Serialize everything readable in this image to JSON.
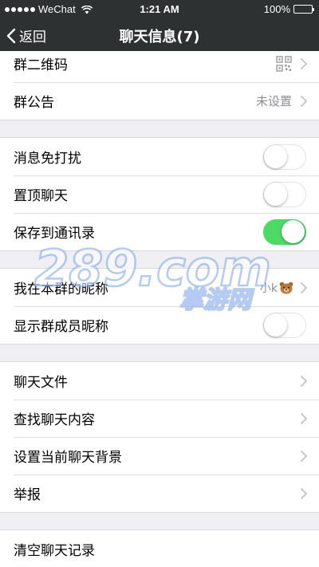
{
  "status_bar": {
    "carrier": "WeChat",
    "time": "1:21 AM",
    "battery": "100%"
  },
  "nav": {
    "back_label": "返回",
    "title": "聊天信息(7)"
  },
  "groups": [
    {
      "rows": [
        {
          "label": "群二维码",
          "accessory": "qr-icon"
        },
        {
          "label": "群公告",
          "value": "未设置"
        }
      ]
    },
    {
      "rows": [
        {
          "label": "消息免打扰",
          "toggle": false
        },
        {
          "label": "置顶聊天",
          "toggle": false
        },
        {
          "label": "保存到通讯录",
          "toggle": true
        }
      ]
    },
    {
      "rows": [
        {
          "label": "我在本群的昵称",
          "value": "小k"
        },
        {
          "label": "显示群成员昵称",
          "toggle": false
        }
      ]
    },
    {
      "rows": [
        {
          "label": "聊天文件"
        },
        {
          "label": "查找聊天内容"
        },
        {
          "label": "设置当前聊天背景"
        },
        {
          "label": "举报"
        }
      ]
    },
    {
      "rows": [
        {
          "label": "清空聊天记录"
        }
      ]
    }
  ],
  "watermark": {
    "text": "289.com",
    "subtext": "掌游网"
  },
  "colors": {
    "nav_bg": "#2e3132",
    "toggle_on": "#4cd964",
    "page_bg": "#efeff4"
  }
}
